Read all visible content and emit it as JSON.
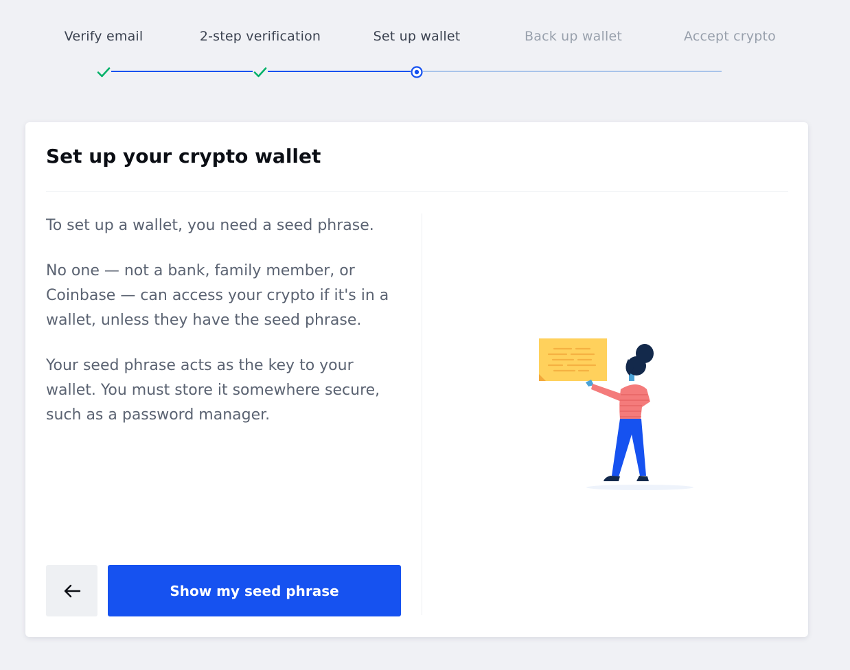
{
  "stepper": {
    "steps": [
      {
        "label": "Verify email",
        "state": "done"
      },
      {
        "label": "2-step verification",
        "state": "done"
      },
      {
        "label": "Set up wallet",
        "state": "current"
      },
      {
        "label": "Back up wallet",
        "state": "pending"
      },
      {
        "label": "Accept crypto",
        "state": "pending"
      }
    ],
    "colors": {
      "done_check": "#05b169",
      "done_track": "#1652f0",
      "pending_track": "#a9c4ea"
    }
  },
  "card": {
    "title": "Set up your crypto wallet",
    "paragraphs": [
      "To set up a wallet, you need a seed phrase.",
      "No one — not a bank, family member, or Coinbase — can access your crypto if it's in a wallet, unless they have the seed phrase.",
      "Your seed phrase acts as the key to your wallet. You must store it somewhere secure, such as a password manager."
    ],
    "back_icon": "arrow-left-icon",
    "primary_button_label": "Show my seed phrase",
    "illustration": "person-holding-note-illustration"
  },
  "colors": {
    "accent": "#1652f0",
    "page_bg": "#f0f1f5"
  }
}
